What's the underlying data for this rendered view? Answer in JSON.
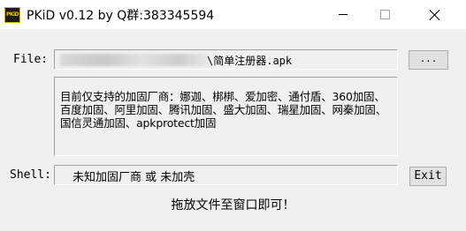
{
  "window": {
    "title": "PKiD v0.12 by Q群:383345594",
    "icon_label": "PKiD",
    "icon": "pkid-app-icon",
    "controls": {
      "minimize": "minimize-icon",
      "maximize": "maximize-icon",
      "close": "close-icon"
    }
  },
  "file": {
    "label": "File:",
    "value_visible": "\\简单注册器.apk",
    "browse_label": "..."
  },
  "info": {
    "text": "目前仅支持的加固厂商：娜迦、梆梆、爱加密、通付盾、360加固、百度加固、阿里加固、腾讯加固、盛大加固、瑞星加固、网秦加固、国信灵通加固、apkprotect加固"
  },
  "shell": {
    "label": "Shell:",
    "value": "未知加固厂商 或 未加壳",
    "exit_label": "Exit"
  },
  "hint": "拖放文件至窗口即可！",
  "colors": {
    "background": "#f0f0f0",
    "titlebar": "#ffffff",
    "button": "#e1e1e1"
  }
}
